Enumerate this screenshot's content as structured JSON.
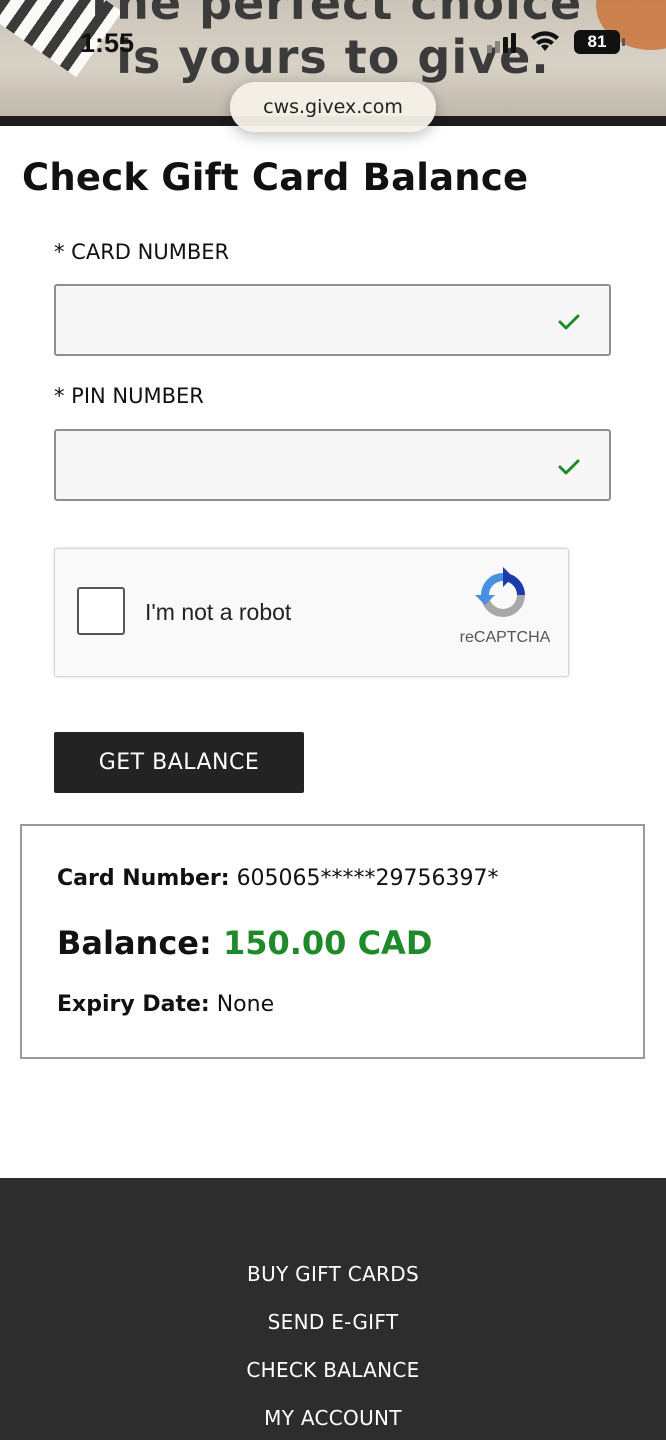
{
  "status_bar": {
    "time": "1:55",
    "battery": "81"
  },
  "browser": {
    "url": "cws.givex.com"
  },
  "hero": {
    "line1": "The perfect choice",
    "line2": "is yours to give."
  },
  "page": {
    "title": "Check Gift Card Balance"
  },
  "form": {
    "card_number_label": "* CARD NUMBER",
    "card_number_value": "",
    "pin_number_label": "* PIN NUMBER",
    "pin_number_value": "",
    "valid_color": "#1e8a2a"
  },
  "recaptcha": {
    "label": "I'm not a robot",
    "brand": "reCAPTCHA",
    "checked": false
  },
  "actions": {
    "get_balance_label": "GET BALANCE"
  },
  "result": {
    "card_number_label": "Card Number:",
    "card_number_value": "605065*****29756397*",
    "balance_label": "Balance:",
    "balance_value": "150.00 CAD",
    "expiry_label": "Expiry Date:",
    "expiry_value": "None"
  },
  "footer": {
    "links": [
      "BUY GIFT CARDS",
      "SEND E-GIFT",
      "CHECK BALANCE",
      "MY ACCOUNT"
    ]
  },
  "colors": {
    "footer_bg": "#2d2d2d",
    "button_bg": "#232323",
    "balance_green": "#1e8a2a"
  }
}
